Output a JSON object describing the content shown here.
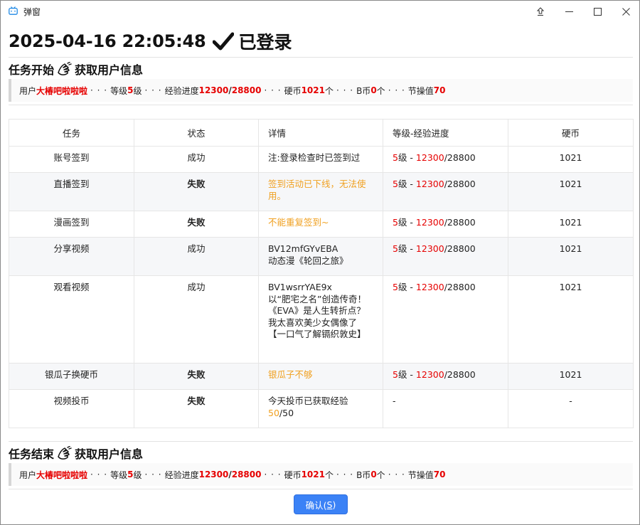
{
  "window": {
    "title": "弹窗",
    "icon": "tv-icon",
    "controls": [
      "pin-icon",
      "minimize-icon",
      "maximize-icon",
      "close-icon"
    ]
  },
  "header": {
    "datetime": "2025-04-16 22:05:48",
    "login_status": "已登录"
  },
  "section_start": {
    "title_prefix": "任务开始",
    "title_suffix": "获取用户信息",
    "user": {
      "label_user": "用户",
      "username": "大椿吧啦啦啦",
      "sep": "· · ·",
      "label_level": "等级",
      "level": "5",
      "level_unit": "级",
      "label_exp": "经验进度",
      "exp_current": "12300",
      "exp_slash": "/",
      "exp_total": "28800",
      "label_coin": "硬币",
      "coin": "1021",
      "coin_unit": "个",
      "label_bcoin": "B币",
      "bcoin": "0",
      "bcoin_unit": "个",
      "label_morality": "节操值",
      "morality": "70"
    }
  },
  "table": {
    "headers": [
      "任务",
      "状态",
      "详情",
      "等级-经验进度",
      "硬币"
    ],
    "rows": [
      {
        "task": "账号签到",
        "status": "成功",
        "status_type": "ok",
        "detail": "注:登录检查时已签到过",
        "detail_type": "normal",
        "level": "5",
        "level_unit": "级 - ",
        "exp": "12300",
        "exp_total": "/28800",
        "coin": "1021"
      },
      {
        "task": "直播签到",
        "status": "失败",
        "status_type": "fail",
        "detail": "签到活动已下线，无法使用。",
        "detail_type": "warn",
        "level": "5",
        "level_unit": "级 - ",
        "exp": "12300",
        "exp_total": "/28800",
        "coin": "1021"
      },
      {
        "task": "漫画签到",
        "status": "失败",
        "status_type": "fail",
        "detail": "不能重复签到~",
        "detail_type": "warn",
        "level": "5",
        "level_unit": "级 - ",
        "exp": "12300",
        "exp_total": "/28800",
        "coin": "1021"
      },
      {
        "task": "分享视频",
        "status": "成功",
        "status_type": "ok",
        "detail": "BV12mfGYvEBA\n动态漫《轮回之旅》",
        "detail_type": "normal",
        "level": "5",
        "level_unit": "级 - ",
        "exp": "12300",
        "exp_total": "/28800",
        "coin": "1021"
      },
      {
        "task": "观看视频",
        "status": "成功",
        "status_type": "ok",
        "detail": "BV1wsrrYAE9x\n以“肥宅之名”创造传奇！《EVA》是人生转折点？ 我太喜欢美少女偶像了【一口气了解镉织敦史】",
        "detail_type": "normal",
        "level": "5",
        "level_unit": "级 - ",
        "exp": "12300",
        "exp_total": "/28800",
        "coin": "1021"
      },
      {
        "task": "银瓜子换硬币",
        "status": "失败",
        "status_type": "fail",
        "detail": "银瓜子不够",
        "detail_type": "warn",
        "level": "5",
        "level_unit": "级 - ",
        "exp": "12300",
        "exp_total": "/28800",
        "coin": "1021"
      },
      {
        "task": "视频投币",
        "status": "失败",
        "status_type": "fail",
        "detail": "今天投币已获取经验",
        "detail_type": "normal",
        "detail_value": "50",
        "detail_total": "/50",
        "level_text": "-",
        "coin_text": "-"
      }
    ]
  },
  "section_end": {
    "title_prefix": "任务结束",
    "title_suffix": "获取用户信息",
    "user": {
      "label_user": "用户",
      "username": "大椿吧啦啦啦",
      "sep": "· · ·",
      "label_level": "等级",
      "level": "5",
      "level_unit": "级",
      "label_exp": "经验进度",
      "exp_current": "12300",
      "exp_slash": "/",
      "exp_total": "28800",
      "label_coin": "硬币",
      "coin": "1021",
      "coin_unit": "个",
      "label_bcoin": "B币",
      "bcoin": "0",
      "bcoin_unit": "个",
      "label_morality": "节操值",
      "morality": "70"
    }
  },
  "footer": {
    "confirm_label": "确认(",
    "confirm_key": "S",
    "confirm_close": ")"
  },
  "colors": {
    "accent": "#3b82f6",
    "fail": "#f0a020",
    "highlight": "#e60000"
  }
}
